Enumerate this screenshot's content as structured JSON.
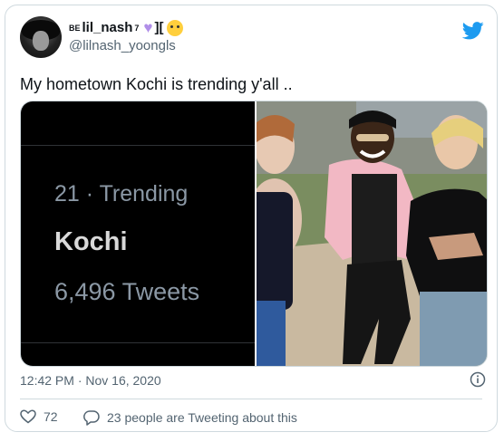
{
  "author": {
    "display_name": "lil_nash",
    "display_prefix": "BE",
    "display_suffix": "7",
    "bracket_glyph": "][",
    "handle": "@lilnash_yoongls"
  },
  "tweet": {
    "text": "My hometown Kochi is trending y'all ..",
    "timestamp": "12:42 PM · Nov 16, 2020"
  },
  "media": {
    "trend_rank": "21 · Trending",
    "trend_term": "Kochi",
    "trend_count": "6,496 Tweets"
  },
  "footer": {
    "like_count": "72",
    "reply_text": "23 people are Tweeting about this"
  },
  "colors": {
    "twitter_blue": "#1d9bf0",
    "muted_text": "#536471",
    "border": "#cfd9de",
    "heart_purple": "#b08ee8"
  },
  "icons": [
    "twitter-bird-icon",
    "info-icon",
    "heart-icon",
    "reply-bubble-icon",
    "purple-heart-emoji",
    "cat-emoji"
  ]
}
